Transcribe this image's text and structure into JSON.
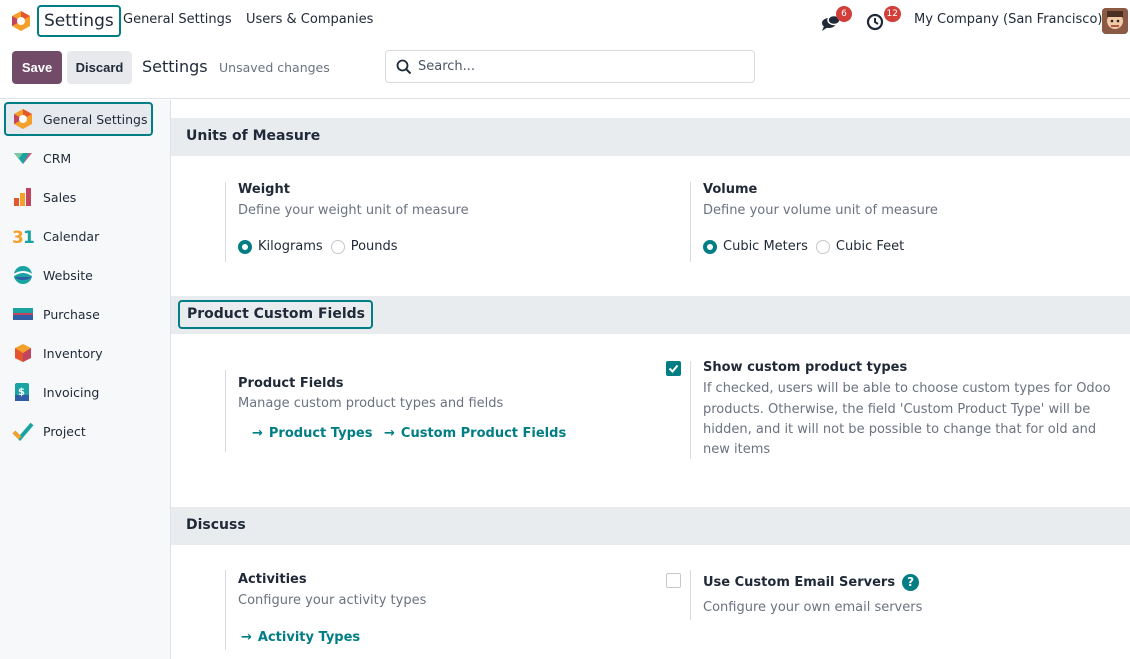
{
  "navbar": {
    "brand": "Settings",
    "menu": [
      "General Settings",
      "Users & Companies"
    ],
    "messages_count": "6",
    "activities_count": "12",
    "company": "My Company (San Francisco)"
  },
  "control_panel": {
    "save_label": "Save",
    "discard_label": "Discard",
    "title": "Settings",
    "status": "Unsaved changes",
    "search_placeholder": "Search..."
  },
  "sidebar": {
    "items": [
      {
        "label": "General Settings",
        "icon": "settings-app-icon",
        "active": true
      },
      {
        "label": "CRM",
        "icon": "crm-app-icon"
      },
      {
        "label": "Sales",
        "icon": "sales-app-icon"
      },
      {
        "label": "Calendar",
        "icon": "calendar-app-icon"
      },
      {
        "label": "Website",
        "icon": "website-app-icon"
      },
      {
        "label": "Purchase",
        "icon": "purchase-app-icon"
      },
      {
        "label": "Inventory",
        "icon": "inventory-app-icon"
      },
      {
        "label": "Invoicing",
        "icon": "invoicing-app-icon"
      },
      {
        "label": "Project",
        "icon": "project-app-icon"
      }
    ]
  },
  "sections": {
    "uom": {
      "title": "Units of Measure",
      "weight": {
        "title": "Weight",
        "desc": "Define your weight unit of measure",
        "options": [
          "Kilograms",
          "Pounds"
        ],
        "selected": "Kilograms"
      },
      "volume": {
        "title": "Volume",
        "desc": "Define your volume unit of measure",
        "options": [
          "Cubic Meters",
          "Cubic Feet"
        ],
        "selected": "Cubic Meters"
      }
    },
    "product_custom": {
      "title": "Product Custom Fields",
      "fields": {
        "title": "Product Fields",
        "desc": "Manage custom product types and fields",
        "links": [
          "Product Types",
          "Custom Product Fields"
        ]
      },
      "custom_types": {
        "title": "Show custom product types",
        "checked": true,
        "desc_lines": [
          "If checked, users will be able to choose custom types for Odoo",
          "products. Otherwise, the field 'Custom Product Type' will be",
          "hidden, and it will not be possible to change that for old and",
          "new items"
        ]
      }
    },
    "discuss": {
      "title": "Discuss",
      "activities": {
        "title": "Activities",
        "desc": "Configure your activity types",
        "link": "Activity Types"
      },
      "email_servers": {
        "title": "Use Custom Email Servers",
        "checked": false,
        "desc": "Configure your own email servers"
      }
    }
  },
  "colors": {
    "accent": "#017e84",
    "primary": "#714b67",
    "badge": "#d23f3a"
  }
}
